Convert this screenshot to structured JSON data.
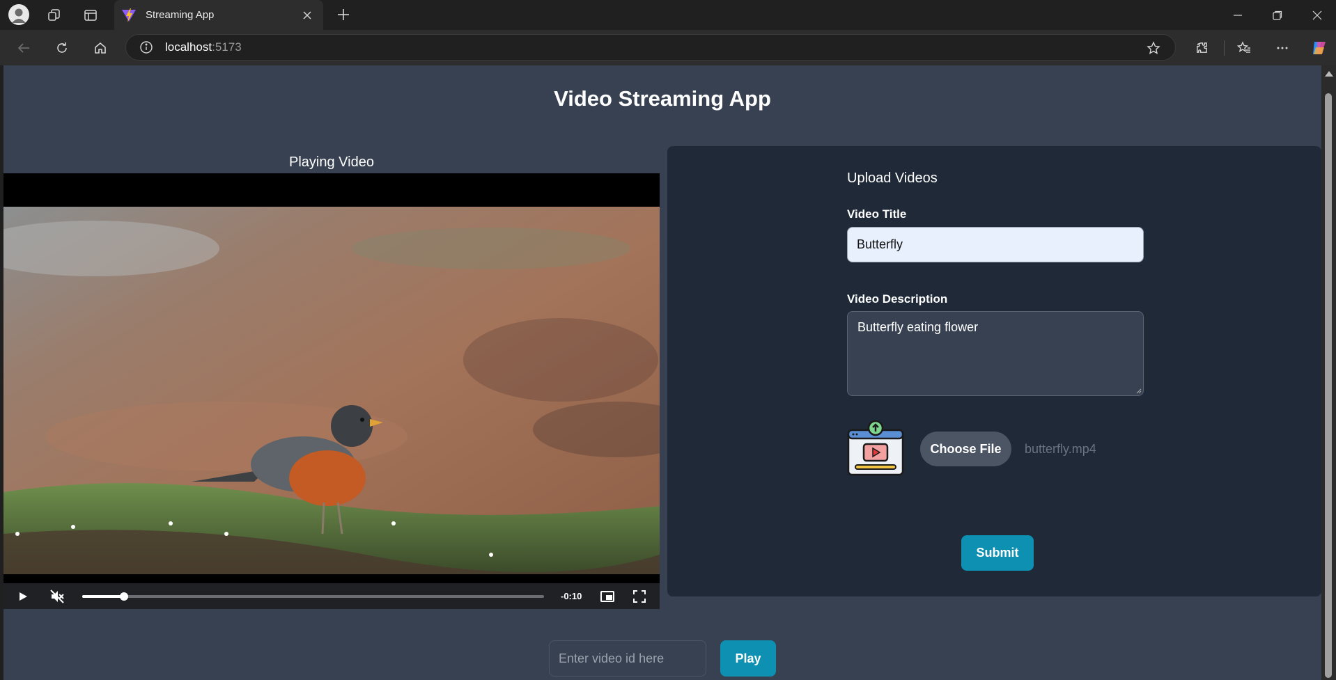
{
  "browser": {
    "tab_title": "Streaming App",
    "address_host": "localhost",
    "address_port": ":5173"
  },
  "page": {
    "app_title": "Video Streaming App"
  },
  "player": {
    "label": "Playing Video",
    "time_remaining": "-0:10",
    "progress_fraction": 0.09,
    "muted": true
  },
  "upload": {
    "heading": "Upload Videos",
    "title_label": "Video Title",
    "title_value": "Butterfly",
    "description_label": "Video Description",
    "description_value": "Butterfly eating flower",
    "choose_file_label": "Choose File",
    "file_name": "butterfly.mp4",
    "submit_label": "Submit"
  },
  "lookup": {
    "placeholder": "Enter video id here",
    "play_label": "Play"
  },
  "colors": {
    "page_bg": "#374151",
    "panel_bg": "#1f2937",
    "accent": "#0e90b3"
  }
}
